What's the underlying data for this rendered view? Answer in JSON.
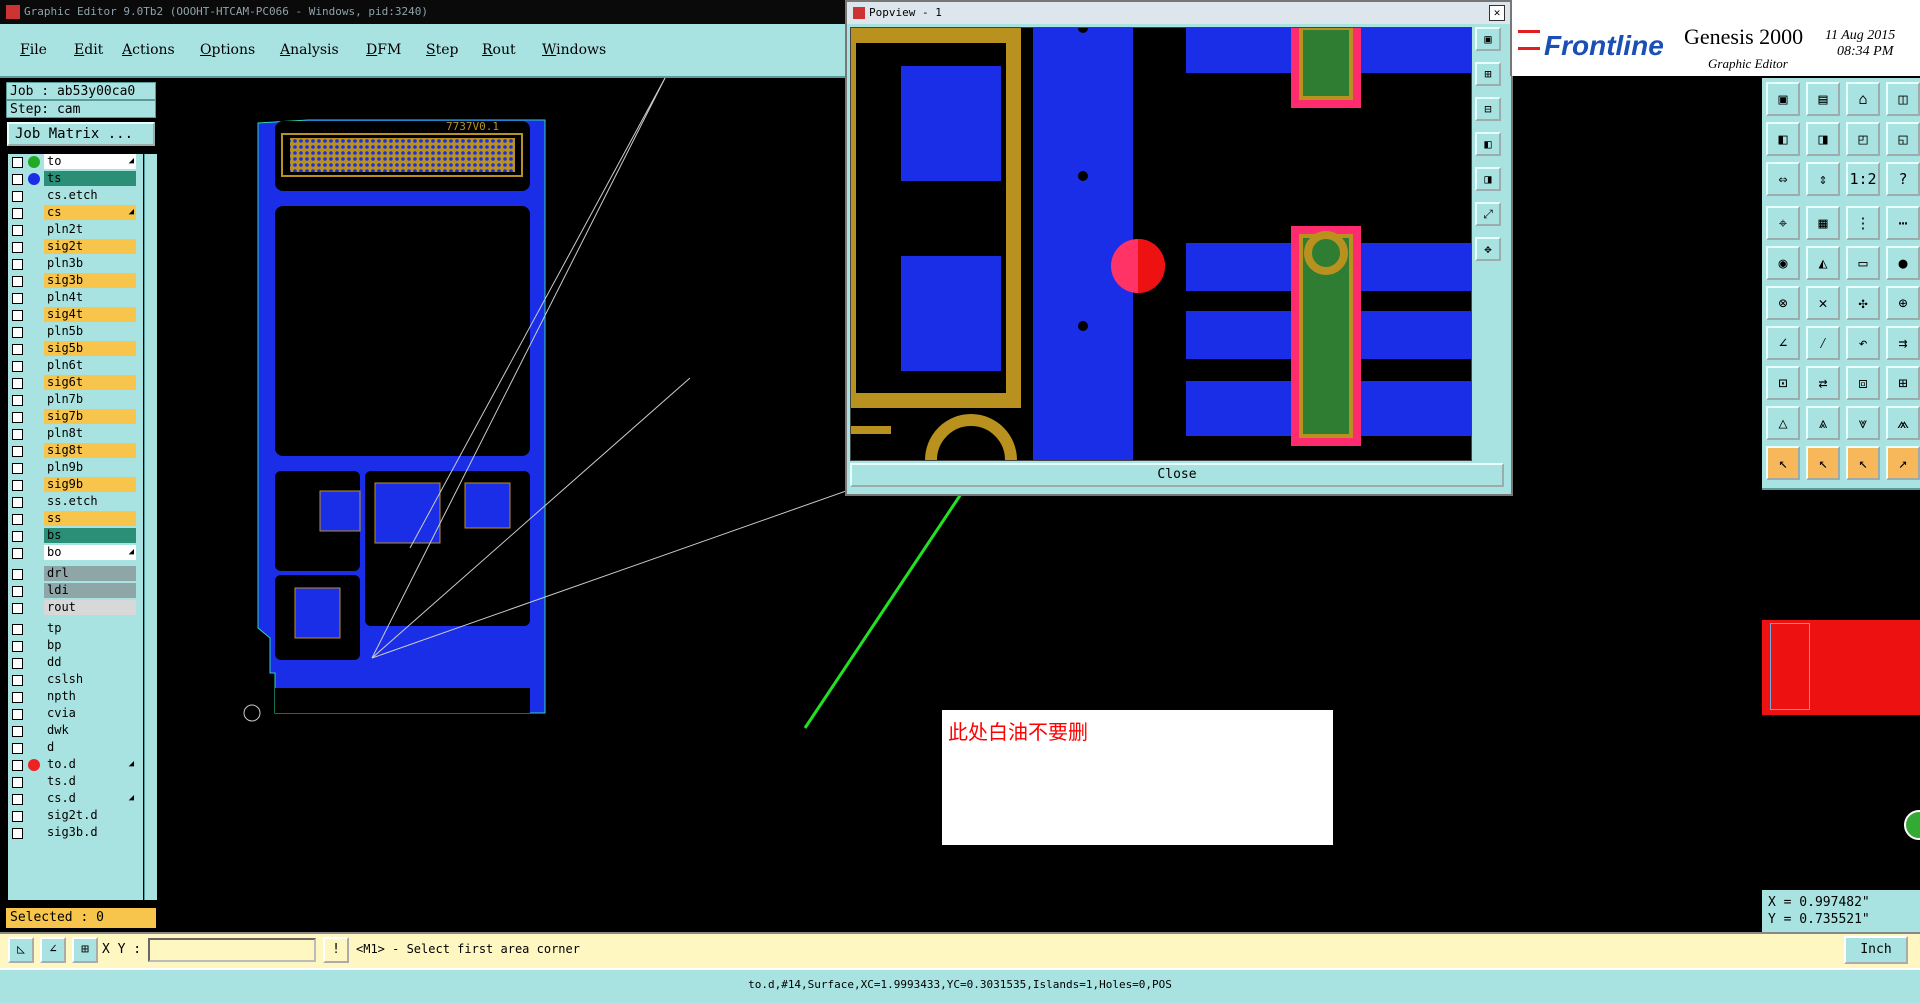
{
  "titlebar": {
    "title": "Graphic Editor 9.0Tb2 (OOOHT-HTCAM-PC066 - Windows, pid:3240)"
  },
  "menu": [
    "File",
    "Edit",
    "Actions",
    "Options",
    "Analysis",
    "DFM",
    "Step",
    "Rout",
    "Windows"
  ],
  "job": {
    "job_label": "Job : ab53y00ca0",
    "step_label": "Step: cam",
    "matrix_button": "Job Matrix ..."
  },
  "layers": [
    {
      "name": "to",
      "color": "#ffffff",
      "dot": "#22aa22",
      "arrow": "◢"
    },
    {
      "name": "ts",
      "color": "#2b8f78",
      "dot": "#1a2ee8",
      "arrow": ""
    },
    {
      "name": "cs.etch",
      "color": "#a9e3e1",
      "dot": "",
      "arrow": ""
    },
    {
      "name": "cs",
      "color": "#f7c54b",
      "dot": "",
      "arrow": "◢"
    },
    {
      "name": "pln2t",
      "color": "#a9e3e1",
      "dot": "",
      "arrow": ""
    },
    {
      "name": "sig2t",
      "color": "#f7c54b",
      "dot": "",
      "arrow": ""
    },
    {
      "name": "pln3b",
      "color": "#a9e3e1",
      "dot": "",
      "arrow": ""
    },
    {
      "name": "sig3b",
      "color": "#f7c54b",
      "dot": "",
      "arrow": ""
    },
    {
      "name": "pln4t",
      "color": "#a9e3e1",
      "dot": "",
      "arrow": ""
    },
    {
      "name": "sig4t",
      "color": "#f7c54b",
      "dot": "",
      "arrow": ""
    },
    {
      "name": "pln5b",
      "color": "#a9e3e1",
      "dot": "",
      "arrow": ""
    },
    {
      "name": "sig5b",
      "color": "#f7c54b",
      "dot": "",
      "arrow": ""
    },
    {
      "name": "pln6t",
      "color": "#a9e3e1",
      "dot": "",
      "arrow": ""
    },
    {
      "name": "sig6t",
      "color": "#f7c54b",
      "dot": "",
      "arrow": ""
    },
    {
      "name": "pln7b",
      "color": "#a9e3e1",
      "dot": "",
      "arrow": ""
    },
    {
      "name": "sig7b",
      "color": "#f7c54b",
      "dot": "",
      "arrow": ""
    },
    {
      "name": "pln8t",
      "color": "#a9e3e1",
      "dot": "",
      "arrow": ""
    },
    {
      "name": "sig8t",
      "color": "#f7c54b",
      "dot": "",
      "arrow": ""
    },
    {
      "name": "pln9b",
      "color": "#a9e3e1",
      "dot": "",
      "arrow": ""
    },
    {
      "name": "sig9b",
      "color": "#f7c54b",
      "dot": "",
      "arrow": ""
    },
    {
      "name": "ss.etch",
      "color": "#a9e3e1",
      "dot": "",
      "arrow": ""
    },
    {
      "name": "ss",
      "color": "#f7c54b",
      "dot": "",
      "arrow": ""
    },
    {
      "name": "bs",
      "color": "#2b8f78",
      "dot": "",
      "arrow": ""
    },
    {
      "name": "bo",
      "color": "#ffffff",
      "dot": "",
      "arrow": "◢"
    },
    {
      "name": "drl",
      "color": "#8fa6a8",
      "dot": "",
      "arrow": ""
    },
    {
      "name": "ldi",
      "color": "#8fa6a8",
      "dot": "",
      "arrow": ""
    },
    {
      "name": "rout",
      "color": "#d8d8d8",
      "dot": "",
      "arrow": ""
    },
    {
      "name": "tp",
      "color": "#a9e3e1",
      "dot": "",
      "arrow": ""
    },
    {
      "name": "bp",
      "color": "#a9e3e1",
      "dot": "",
      "arrow": ""
    },
    {
      "name": "dd",
      "color": "#a9e3e1",
      "dot": "",
      "arrow": ""
    },
    {
      "name": "cslsh",
      "color": "#a9e3e1",
      "dot": "",
      "arrow": ""
    },
    {
      "name": "npth",
      "color": "#a9e3e1",
      "dot": "",
      "arrow": ""
    },
    {
      "name": "cvia",
      "color": "#a9e3e1",
      "dot": "",
      "arrow": ""
    },
    {
      "name": "dwk",
      "color": "#a9e3e1",
      "dot": "",
      "arrow": ""
    },
    {
      "name": "d",
      "color": "#a9e3e1",
      "dot": "",
      "arrow": ""
    },
    {
      "name": "to.d",
      "color": "#a9e3e1",
      "dot": "#ee2222",
      "arrow": "◢"
    },
    {
      "name": "ts.d",
      "color": "#a9e3e1",
      "dot": "",
      "arrow": ""
    },
    {
      "name": "cs.d",
      "color": "#a9e3e1",
      "dot": "",
      "arrow": "◢"
    },
    {
      "name": "sig2t.d",
      "color": "#a9e3e1",
      "dot": "",
      "arrow": ""
    },
    {
      "name": "sig3b.d",
      "color": "#a9e3e1",
      "dot": "",
      "arrow": ""
    }
  ],
  "selected_label": "Selected : 0",
  "board_text": "7737V0.1",
  "popview": {
    "title": "Popview - 1",
    "close_label": "Close"
  },
  "annotation": {
    "text": "此处白油不要删"
  },
  "header": {
    "brand": "Frontline",
    "product": "Genesis 2000",
    "subtitle": "Graphic Editor",
    "date": "11 Aug 2015",
    "time": "08:34 PM"
  },
  "coords": {
    "x": "X = 0.997482\"",
    "y": "Y = 0.735521\""
  },
  "bottom": {
    "xy_label": "X Y :",
    "xy_value": "",
    "prompt": "<M1> - Select first area corner",
    "units": "Inch"
  },
  "status": "to.d,#14,Surface,XC=1.9993433,YC=0.3031535,Islands=1,Holes=0,POS",
  "colors": {
    "panel": "#a9e3e1",
    "accent": "#f7c54b",
    "board": "#1a2ee8",
    "arrow": "#22e022",
    "highlight": "#ff3366"
  }
}
